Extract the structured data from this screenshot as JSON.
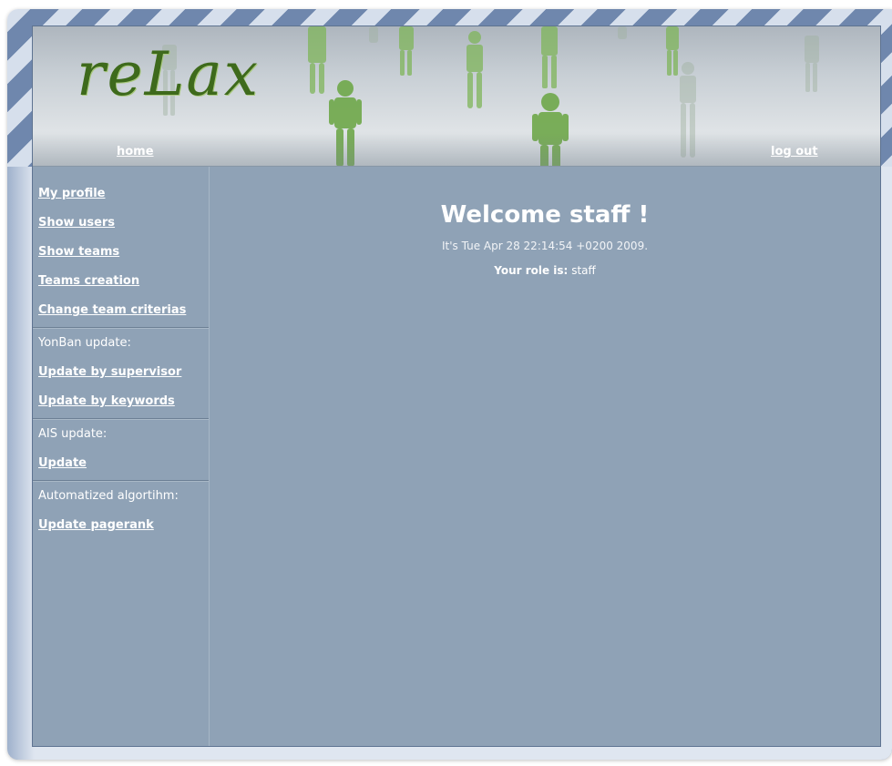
{
  "header": {
    "logo_text": "reLax",
    "home_label": "home",
    "logout_label": "log out"
  },
  "sidebar": {
    "items": [
      {
        "label": "My profile"
      },
      {
        "label": "Show users"
      },
      {
        "label": "Show teams"
      },
      {
        "label": "Teams creation"
      },
      {
        "label": "Change team criterias"
      }
    ],
    "yonban_heading": "YonBan update:",
    "yonban_items": [
      {
        "label": "Update by supervisor"
      },
      {
        "label": "Update by keywords"
      }
    ],
    "ais_heading": "AIS update:",
    "ais_items": [
      {
        "label": "Update"
      }
    ],
    "algo_heading": "Automatized algortihm:",
    "algo_items": [
      {
        "label": "Update pagerank"
      }
    ]
  },
  "main": {
    "welcome": "Welcome staff !",
    "date_line": "It's Tue Apr 28 22:14:54 +0200 2009.",
    "role_label": "Your role is:",
    "role_value": "staff"
  },
  "colors": {
    "content_bg": "#8fa2b6",
    "logo_green": "#3e6a1c",
    "figure_green": "#6fa84a"
  }
}
